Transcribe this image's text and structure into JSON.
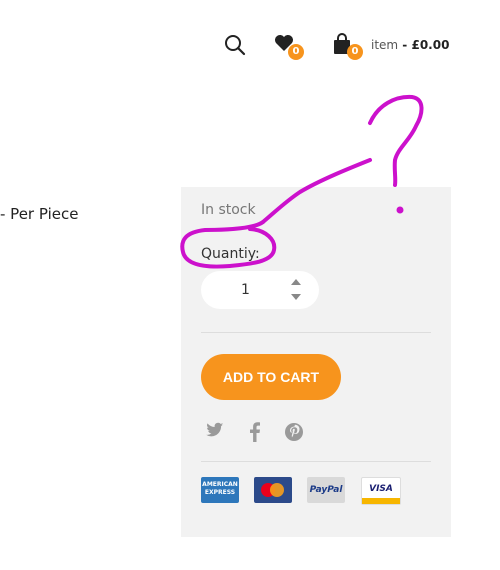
{
  "header": {
    "wishlist_count": "0",
    "cart_count": "0",
    "cart_label": "item",
    "cart_separator": " - ",
    "cart_total": "£0.00"
  },
  "product": {
    "price_suffix": "- Per Piece"
  },
  "panel": {
    "stock_status": "In stock",
    "quantity_label": "Quantiy:",
    "quantity_value": "1",
    "add_to_cart_label": "ADD TO CART"
  },
  "social": [
    "twitter-icon",
    "facebook-icon",
    "pinterest-icon"
  ],
  "payments": {
    "amex_label": "AMERICAN EXPRESS",
    "paypal_label": "PayPal",
    "visa_label": "VISA"
  },
  "colors": {
    "accent": "#f7941d",
    "panel_bg": "#f2f2f2",
    "annotation": "#cc11cc"
  }
}
